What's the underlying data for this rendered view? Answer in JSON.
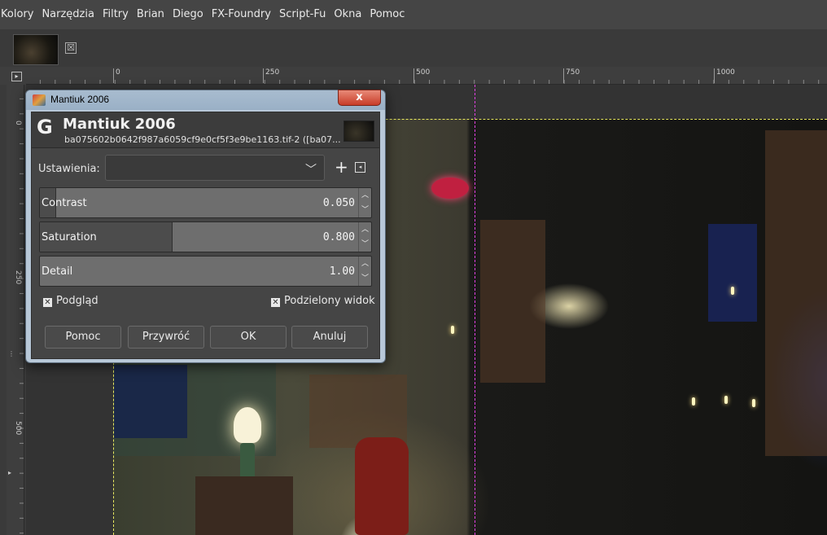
{
  "menubar": {
    "items": [
      "Kolory",
      "Narzędzia",
      "Filtry",
      "Brian",
      "Diego",
      "FX-Foundry",
      "Script-Fu",
      "Okna",
      "Pomoc"
    ]
  },
  "tabs": {
    "close_glyph": "☒"
  },
  "rulers": {
    "top_ticks": [
      "0",
      "250",
      "500",
      "750",
      "1000"
    ],
    "left_ticks": [
      "0",
      "250",
      "500"
    ]
  },
  "dialog": {
    "window_title": "Mantiuk 2006",
    "close_glyph": "x",
    "header_title": "Mantiuk 2006",
    "header_subtitle": "ba075602b0642f987a6059cf9e0cf5f3e9be1163.tif-2 ([ba07...",
    "presets_label": "Ustawienia:",
    "presets_value": "",
    "sliders": [
      {
        "label": "Contrast",
        "value": "0.050",
        "fraction": 0.05
      },
      {
        "label": "Saturation",
        "value": "0.800",
        "fraction": 0.4
      },
      {
        "label": "Detail",
        "value": "1.00",
        "fraction": 0.0
      }
    ],
    "preview_label": "Podgląd",
    "preview_checked": true,
    "split_label": "Podzielony widok",
    "split_checked": true,
    "buttons": {
      "help": "Pomoc",
      "reset": "Przywróć",
      "ok": "OK",
      "cancel": "Anuluj"
    }
  },
  "colors": {
    "split_guide": "#e040e0",
    "selection": "#e8e860",
    "close_button": "#c83c28"
  }
}
